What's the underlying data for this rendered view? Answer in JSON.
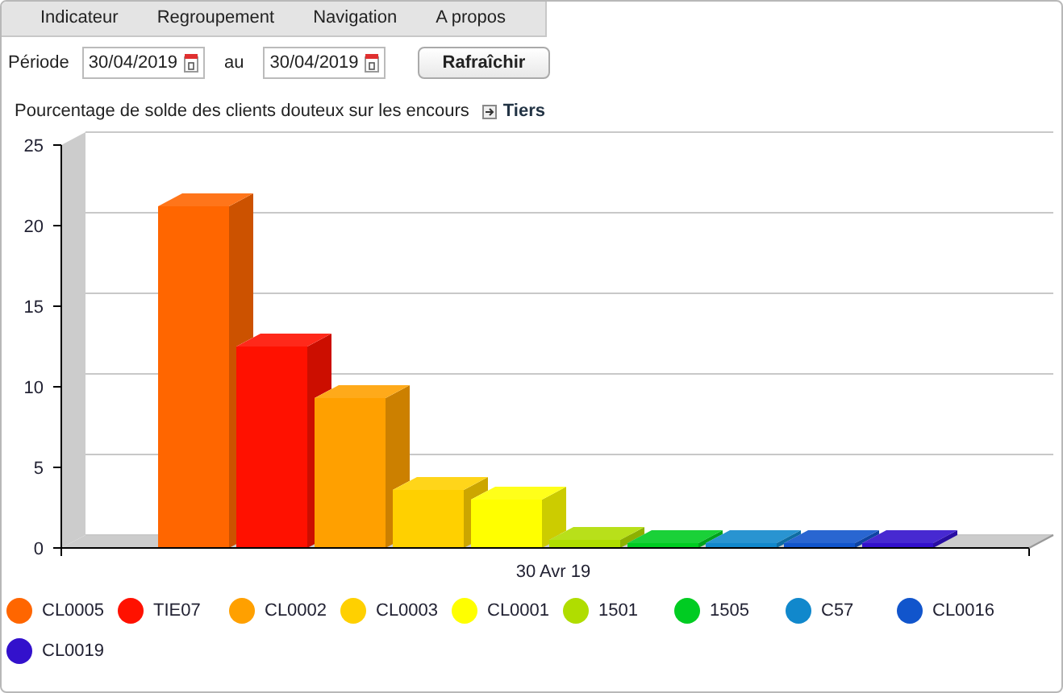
{
  "menu": [
    {
      "label": "Indicateur"
    },
    {
      "label": "Regroupement"
    },
    {
      "label": "Navigation"
    },
    {
      "label": "A propos"
    }
  ],
  "period": {
    "label": "Période",
    "from": "30/04/2019",
    "separator": "au",
    "to": "30/04/2019",
    "button": "Rafraîchir"
  },
  "chart": {
    "title": "Pourcentage de solde des clients douteux sur les encours",
    "link": "Tiers",
    "chart_data": {
      "type": "bar",
      "categories": [
        "30 Avr 19"
      ],
      "ylim": [
        0,
        25
      ],
      "yticks": [
        0,
        5,
        10,
        15,
        20,
        25
      ],
      "series": [
        {
          "name": "CL0005",
          "color": "#ff6600",
          "values": [
            21.2
          ]
        },
        {
          "name": "TIE07",
          "color": "#ff1100",
          "values": [
            12.5
          ]
        },
        {
          "name": "CL0002",
          "color": "#ffa000",
          "values": [
            9.3
          ]
        },
        {
          "name": "CL0003",
          "color": "#ffd000",
          "values": [
            3.6
          ]
        },
        {
          "name": "CL0001",
          "color": "#ffff00",
          "values": [
            3.0
          ]
        },
        {
          "name": "1501",
          "color": "#b0dd00",
          "values": [
            0.5
          ]
        },
        {
          "name": "1505",
          "color": "#00cc22",
          "values": [
            0.3
          ]
        },
        {
          "name": "C57",
          "color": "#1188cc",
          "values": [
            0.3
          ]
        },
        {
          "name": "CL0016",
          "color": "#1155cc",
          "values": [
            0.3
          ]
        },
        {
          "name": "CL0019",
          "color": "#3311cc",
          "values": [
            0.3
          ]
        }
      ]
    }
  }
}
